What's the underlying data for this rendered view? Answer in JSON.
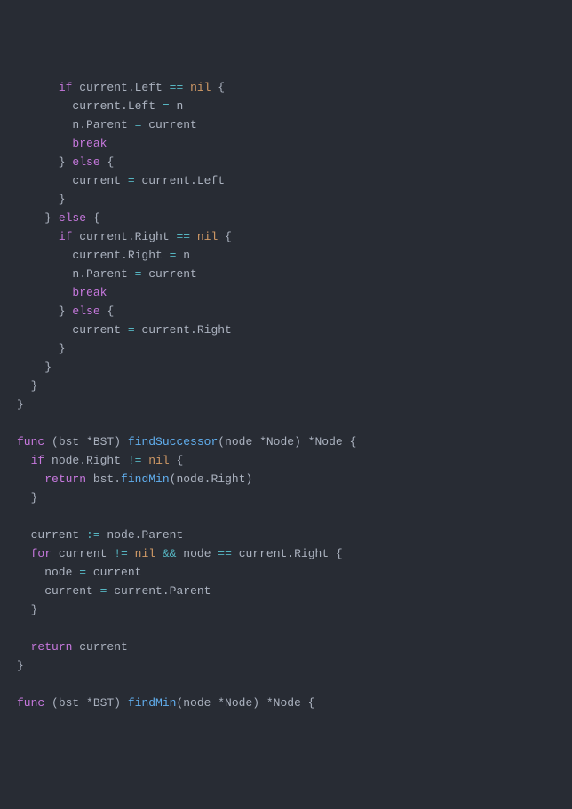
{
  "code": {
    "tokens": [
      [
        {
          "t": "      ",
          "c": "id"
        },
        {
          "t": "if",
          "c": "kw"
        },
        {
          "t": " current.Left ",
          "c": "id"
        },
        {
          "t": "==",
          "c": "eq"
        },
        {
          "t": " ",
          "c": "id"
        },
        {
          "t": "nil",
          "c": "nil"
        },
        {
          "t": " {",
          "c": "id"
        }
      ],
      [
        {
          "t": "        current.Left ",
          "c": "id"
        },
        {
          "t": "=",
          "c": "eq"
        },
        {
          "t": " n",
          "c": "id"
        }
      ],
      [
        {
          "t": "        n.Parent ",
          "c": "id"
        },
        {
          "t": "=",
          "c": "eq"
        },
        {
          "t": " current",
          "c": "id"
        }
      ],
      [
        {
          "t": "        ",
          "c": "id"
        },
        {
          "t": "break",
          "c": "kw"
        }
      ],
      [
        {
          "t": "      } ",
          "c": "id"
        },
        {
          "t": "else",
          "c": "kw"
        },
        {
          "t": " {",
          "c": "id"
        }
      ],
      [
        {
          "t": "        current ",
          "c": "id"
        },
        {
          "t": "=",
          "c": "eq"
        },
        {
          "t": " current.Left",
          "c": "id"
        }
      ],
      [
        {
          "t": "      }",
          "c": "id"
        }
      ],
      [
        {
          "t": "    } ",
          "c": "id"
        },
        {
          "t": "else",
          "c": "kw"
        },
        {
          "t": " {",
          "c": "id"
        }
      ],
      [
        {
          "t": "      ",
          "c": "id"
        },
        {
          "t": "if",
          "c": "kw"
        },
        {
          "t": " current.Right ",
          "c": "id"
        },
        {
          "t": "==",
          "c": "eq"
        },
        {
          "t": " ",
          "c": "id"
        },
        {
          "t": "nil",
          "c": "nil"
        },
        {
          "t": " {",
          "c": "id"
        }
      ],
      [
        {
          "t": "        current.Right ",
          "c": "id"
        },
        {
          "t": "=",
          "c": "eq"
        },
        {
          "t": " n",
          "c": "id"
        }
      ],
      [
        {
          "t": "        n.Parent ",
          "c": "id"
        },
        {
          "t": "=",
          "c": "eq"
        },
        {
          "t": " current",
          "c": "id"
        }
      ],
      [
        {
          "t": "        ",
          "c": "id"
        },
        {
          "t": "break",
          "c": "kw"
        }
      ],
      [
        {
          "t": "      } ",
          "c": "id"
        },
        {
          "t": "else",
          "c": "kw"
        },
        {
          "t": " {",
          "c": "id"
        }
      ],
      [
        {
          "t": "        current ",
          "c": "id"
        },
        {
          "t": "=",
          "c": "eq"
        },
        {
          "t": " current.Right",
          "c": "id"
        }
      ],
      [
        {
          "t": "      }",
          "c": "id"
        }
      ],
      [
        {
          "t": "    }",
          "c": "id"
        }
      ],
      [
        {
          "t": "  }",
          "c": "id"
        }
      ],
      [
        {
          "t": "}",
          "c": "id"
        }
      ],
      [
        {
          "t": "",
          "c": "id"
        }
      ],
      [
        {
          "t": "func",
          "c": "kw"
        },
        {
          "t": " (bst *BST) ",
          "c": "id"
        },
        {
          "t": "findSuccessor",
          "c": "fn"
        },
        {
          "t": "(node *Node) *Node {",
          "c": "id"
        }
      ],
      [
        {
          "t": "  ",
          "c": "id"
        },
        {
          "t": "if",
          "c": "kw"
        },
        {
          "t": " node.Right ",
          "c": "id"
        },
        {
          "t": "!=",
          "c": "eq"
        },
        {
          "t": " ",
          "c": "id"
        },
        {
          "t": "nil",
          "c": "nil"
        },
        {
          "t": " {",
          "c": "id"
        }
      ],
      [
        {
          "t": "    ",
          "c": "id"
        },
        {
          "t": "return",
          "c": "kw"
        },
        {
          "t": " bst.",
          "c": "id"
        },
        {
          "t": "findMin",
          "c": "fn"
        },
        {
          "t": "(node.Right)",
          "c": "id"
        }
      ],
      [
        {
          "t": "  }",
          "c": "id"
        }
      ],
      [
        {
          "t": "",
          "c": "id"
        }
      ],
      [
        {
          "t": "  current ",
          "c": "id"
        },
        {
          "t": ":=",
          "c": "eq"
        },
        {
          "t": " node.Parent",
          "c": "id"
        }
      ],
      [
        {
          "t": "  ",
          "c": "id"
        },
        {
          "t": "for",
          "c": "kw"
        },
        {
          "t": " current ",
          "c": "id"
        },
        {
          "t": "!=",
          "c": "eq"
        },
        {
          "t": " ",
          "c": "id"
        },
        {
          "t": "nil",
          "c": "nil"
        },
        {
          "t": " ",
          "c": "id"
        },
        {
          "t": "&&",
          "c": "eq"
        },
        {
          "t": " node ",
          "c": "id"
        },
        {
          "t": "==",
          "c": "eq"
        },
        {
          "t": " current.Right {",
          "c": "id"
        }
      ],
      [
        {
          "t": "    node ",
          "c": "id"
        },
        {
          "t": "=",
          "c": "eq"
        },
        {
          "t": " current",
          "c": "id"
        }
      ],
      [
        {
          "t": "    current ",
          "c": "id"
        },
        {
          "t": "=",
          "c": "eq"
        },
        {
          "t": " current.Parent",
          "c": "id"
        }
      ],
      [
        {
          "t": "  }",
          "c": "id"
        }
      ],
      [
        {
          "t": "",
          "c": "id"
        }
      ],
      [
        {
          "t": "  ",
          "c": "id"
        },
        {
          "t": "return",
          "c": "kw"
        },
        {
          "t": " current",
          "c": "id"
        }
      ],
      [
        {
          "t": "}",
          "c": "id"
        }
      ],
      [
        {
          "t": "",
          "c": "id"
        }
      ],
      [
        {
          "t": "func",
          "c": "kw"
        },
        {
          "t": " (bst *BST) ",
          "c": "id"
        },
        {
          "t": "findMin",
          "c": "fn"
        },
        {
          "t": "(node *Node) *Node {",
          "c": "id"
        }
      ]
    ]
  }
}
